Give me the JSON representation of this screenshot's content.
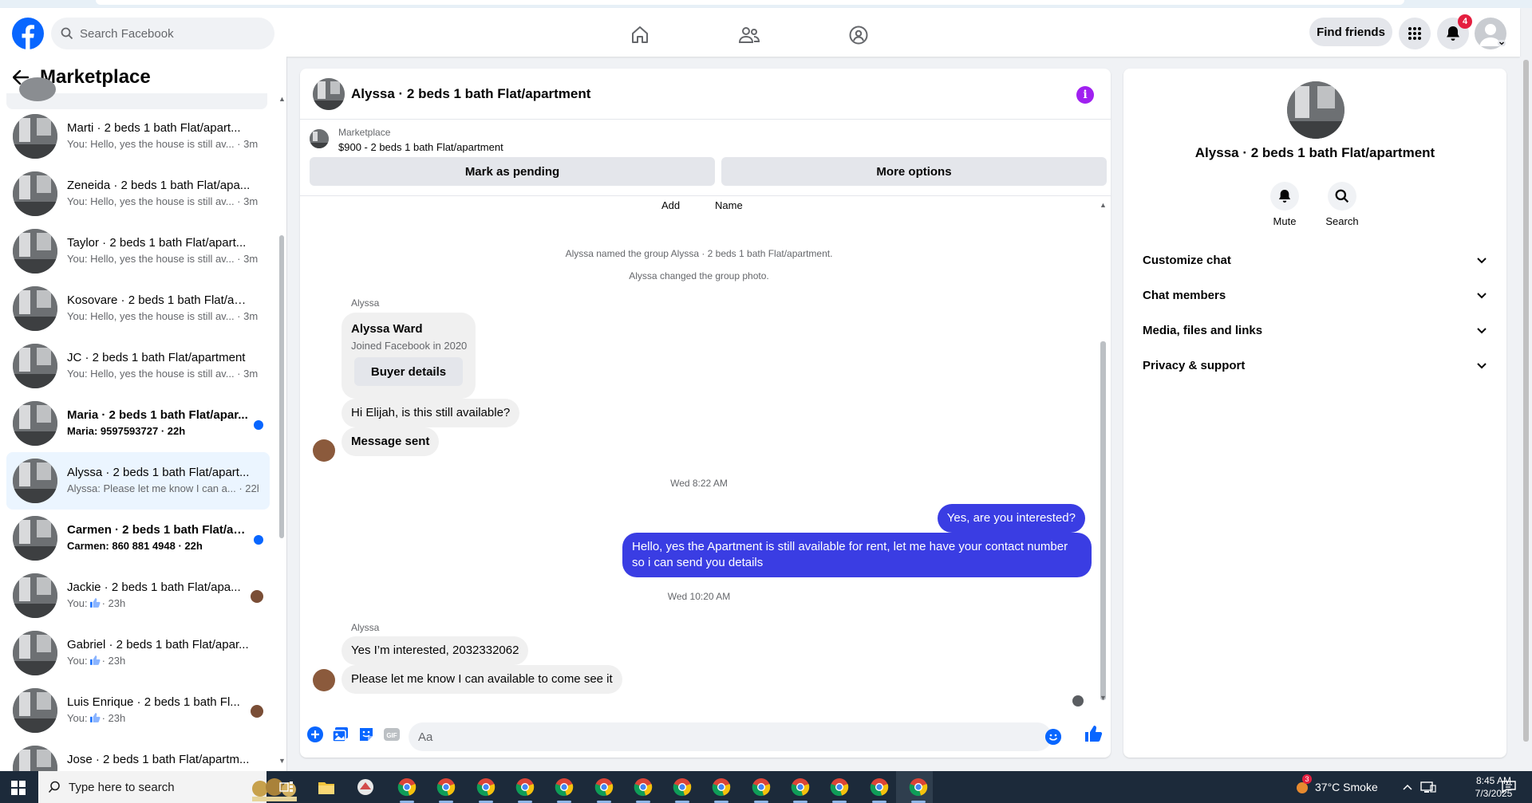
{
  "header": {
    "search_placeholder": "Search Facebook",
    "find_friends_label": "Find friends",
    "notification_count": "4"
  },
  "sidebar": {
    "title": "Marketplace",
    "conversations": [
      {
        "name": "Marti · 2 beds 1 bath Flat/apart...",
        "preview": "You: Hello, yes the house is still av... · 3m",
        "unread": false,
        "marker": "none"
      },
      {
        "name": "Zeneida · 2 beds 1 bath Flat/apa...",
        "preview": "You: Hello, yes the house is still av... · 3m",
        "unread": false,
        "marker": "none"
      },
      {
        "name": "Taylor · 2 beds 1 bath Flat/apart...",
        "preview": "You: Hello, yes the house is still av... · 3m",
        "unread": false,
        "marker": "none"
      },
      {
        "name": "Kosovare · 2 beds 1 bath Flat/ap...",
        "preview": "You: Hello, yes the house is still av... · 3m",
        "unread": false,
        "marker": "none"
      },
      {
        "name": "JC · 2 beds 1 bath Flat/apartment",
        "preview": "You: Hello, yes the house is still av... · 3m",
        "unread": false,
        "marker": "none"
      },
      {
        "name": "Maria · 2 beds 1 bath Flat/apar...",
        "preview": "Maria: 9597593727 · 22h",
        "unread": true,
        "marker": "dot"
      },
      {
        "name": "Alyssa · 2 beds 1 bath Flat/apart...",
        "preview": "Alyssa: Please let me know I can a... · 22h",
        "unread": false,
        "marker": "none",
        "active": true
      },
      {
        "name": "Carmen · 2 beds 1 bath Flat/ap...",
        "preview": "Carmen: 860 881 4948 · 22h",
        "unread": true,
        "marker": "dot"
      },
      {
        "name": "Jackie · 2 beds 1 bath Flat/apa...",
        "preview_prefix": "You:",
        "preview_suffix": "· 23h",
        "like": true,
        "unread": false,
        "marker": "avatar"
      },
      {
        "name": "Gabriel · 2 beds 1 bath Flat/apar...",
        "preview_prefix": "You:",
        "preview_suffix": "· 23h",
        "like": true,
        "unread": false,
        "marker": "none"
      },
      {
        "name": "Luis Enrique · 2 beds 1 bath Fl...",
        "preview_prefix": "You:",
        "preview_suffix": "· 23h",
        "like": true,
        "unread": false,
        "marker": "avatar"
      },
      {
        "name": "Jose · 2 beds 1 bath Flat/apartm...",
        "preview": "",
        "unread": false,
        "marker": "none"
      }
    ]
  },
  "chat": {
    "title": "Alyssa · 2 beds 1 bath Flat/apartment",
    "marketplace_label": "Marketplace",
    "listing": "$900 - 2 beds 1 bath Flat/apartment",
    "mark_pending_label": "Mark as pending",
    "more_options_label": "More options",
    "add_label": "Add",
    "name_label": "Name",
    "system_messages": [
      "Alyssa named the group Alyssa · 2 beds 1 bath Flat/apartment.",
      "Alyssa changed the group photo."
    ],
    "sender_name": "Alyssa",
    "profile_card": {
      "name": "Alyssa Ward",
      "joined": "Joined Facebook in 2020",
      "button": "Buyer details"
    },
    "messages_1": [
      "Hi Elijah, is this still available?",
      "Message sent"
    ],
    "timestamp_1": "Wed 8:22 AM",
    "my_messages": [
      "Yes, are you interested?",
      "Hello, yes the Apartment is still available for rent, let me have your contact number so i can send you details"
    ],
    "timestamp_2": "Wed 10:20 AM",
    "messages_2": [
      "Yes I’m interested, 2032332062",
      "Please let me know I can available to come see it"
    ],
    "composer_placeholder": "Aa"
  },
  "right_panel": {
    "name": "Alyssa · 2 beds 1 bath Flat/apartment",
    "mute_label": "Mute",
    "search_label": "Search",
    "sections": [
      "Customize chat",
      "Chat members",
      "Media, files and links",
      "Privacy & support"
    ]
  },
  "taskbar": {
    "search_placeholder": "Type here to search",
    "weather": "37°C  Smoke",
    "weather_badge": "3",
    "time": "8:45 AM",
    "date": "7/3/2025"
  },
  "colors": {
    "brand_blue": "#0866ff",
    "my_bubble": "#3a3de3",
    "notification_red": "#e41e3f",
    "info_purple": "#a020f0"
  }
}
